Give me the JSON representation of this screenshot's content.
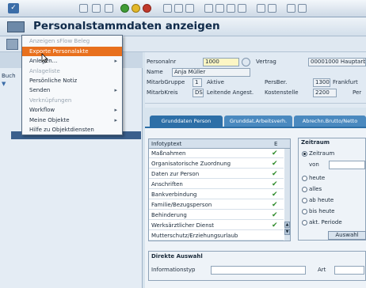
{
  "title": "Personalstammdaten anzeigen",
  "menu": {
    "items": [
      {
        "label": "Anzeigen sFlow Beleg",
        "disabled": true,
        "highlighted": false,
        "submenu": false
      },
      {
        "label": "Exporte Personalakte",
        "disabled": false,
        "highlighted": true,
        "submenu": false
      },
      {
        "label": "Anlegen...",
        "disabled": false,
        "highlighted": false,
        "submenu": true
      },
      {
        "label": "Anlageliste",
        "disabled": true,
        "highlighted": false,
        "submenu": false
      },
      {
        "label": "Persönliche Notiz",
        "disabled": false,
        "highlighted": false,
        "submenu": false
      },
      {
        "label": "Senden",
        "disabled": false,
        "highlighted": false,
        "submenu": true
      },
      {
        "label": "Verknüpfungen",
        "disabled": true,
        "highlighted": false,
        "submenu": false
      },
      {
        "label": "Workflow",
        "disabled": false,
        "highlighted": false,
        "submenu": true
      },
      {
        "label": "Meine Objekte",
        "disabled": false,
        "highlighted": false,
        "submenu": true
      },
      {
        "label": "Hilfe zu Objektdiensten",
        "disabled": false,
        "highlighted": false,
        "submenu": false
      }
    ]
  },
  "leftpanel": {
    "buch_label": "Buch"
  },
  "header": {
    "personalnr_label": "Personalnr",
    "personalnr_value": "1000",
    "vertrag_label": "Vertrag",
    "vertrag_value": "00001000 Hauptarb",
    "name_label": "Name",
    "name_value": "Anja Müller",
    "mitarbgruppe_label": "MitarbGruppe",
    "mitarbgruppe_code": "1",
    "mitarbgruppe_text": "Aktive",
    "persber_label": "PersBer.",
    "persber_code": "1300",
    "persber_text": "Frankfurt",
    "mitarbkreis_label": "MitarbKreis",
    "mitarbkreis_code": "DS",
    "mitarbkreis_text": "Leitende Angest.",
    "kostenstelle_label": "Kostenstelle",
    "kostenstelle_value": "2200",
    "kostenstelle_text": "Per"
  },
  "tabs": [
    {
      "label": "Grunddaten Person",
      "active": true
    },
    {
      "label": "Grunddat.Arbeitsverh.",
      "active": false
    },
    {
      "label": "Abrechn.Brutto/Netto",
      "active": false
    }
  ],
  "infotypes": {
    "header_label": "Infotyptext",
    "header_e": "E",
    "rows": [
      {
        "text": "Maßnahmen",
        "checked": true
      },
      {
        "text": "Organisatorische Zuordnung",
        "checked": true
      },
      {
        "text": "Daten zur Person",
        "checked": true
      },
      {
        "text": "Anschriften",
        "checked": true
      },
      {
        "text": "Bankverbindung",
        "checked": true
      },
      {
        "text": "Familie/Bezugsperson",
        "checked": true
      },
      {
        "text": "Behinderung",
        "checked": true
      },
      {
        "text": "Werksärztlicher Dienst",
        "checked": true
      },
      {
        "text": "Mutterschutz/Erziehungsurlaub",
        "checked": false
      }
    ]
  },
  "zeitraum": {
    "title": "Zeitraum",
    "options": [
      {
        "label": "Zeitraum",
        "selected": true
      },
      {
        "label": "heute",
        "selected": false
      },
      {
        "label": "alles",
        "selected": false
      },
      {
        "label": "ab heute",
        "selected": false
      },
      {
        "label": "bis heute",
        "selected": false
      },
      {
        "label": "akt. Periode",
        "selected": false
      }
    ],
    "von_label": "von",
    "auswahl_button": "Auswahl"
  },
  "direkte_auswahl": {
    "title": "Direkte Auswahl",
    "infotyp_label": "Informationstyp",
    "art_label": "Art"
  }
}
